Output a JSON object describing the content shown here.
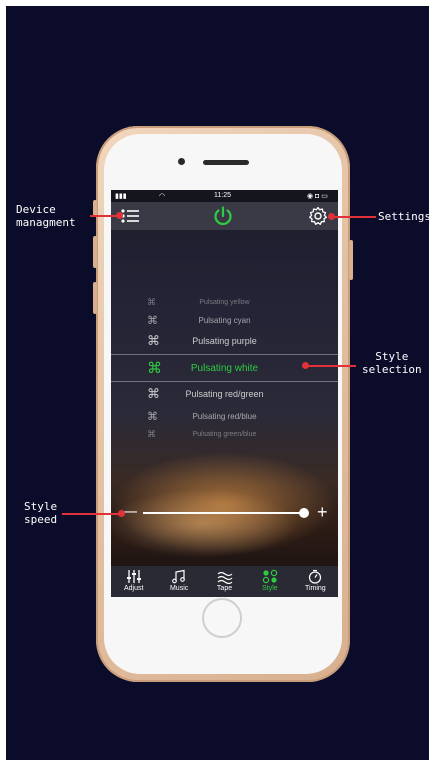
{
  "annotations": {
    "device_management": "Device\nmanagment",
    "settings": "Settings",
    "style_selection": "Style\nselection",
    "style_speed": "Style\nspeed"
  },
  "status_bar": {
    "time": "11:25"
  },
  "style_list": [
    {
      "label": "Pulsating yellow",
      "selected": false
    },
    {
      "label": "Pulsating cyan",
      "selected": false
    },
    {
      "label": "Pulsating purple",
      "selected": false
    },
    {
      "label": "Pulsating white",
      "selected": true
    },
    {
      "label": "Pulsating red/green",
      "selected": false
    },
    {
      "label": "Pulsating red/blue",
      "selected": false
    },
    {
      "label": "Pulsating green/blue",
      "selected": false
    }
  ],
  "slider": {
    "minus": "—",
    "plus": "+",
    "value": 0.96
  },
  "tabs": [
    {
      "label": "Adjust",
      "icon": "sliders-icon",
      "active": false
    },
    {
      "label": "Music",
      "icon": "music-note-icon",
      "active": false
    },
    {
      "label": "Tape",
      "icon": "tape-wave-icon",
      "active": false
    },
    {
      "label": "Style",
      "icon": "style-pattern-icon",
      "active": true
    },
    {
      "label": "Timing",
      "icon": "timer-icon",
      "active": false
    }
  ],
  "colors": {
    "accent": "#2ecc40",
    "annotation": "#e3313a",
    "background": "#0b0b2a"
  }
}
